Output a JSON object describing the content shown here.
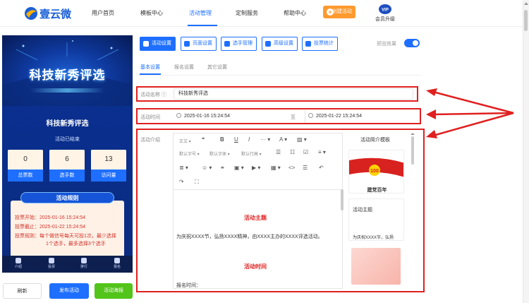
{
  "brand": {
    "name": "壹云微",
    "accent": "#1e6fff",
    "orange": "#ff9a2e",
    "green": "#52c41a",
    "alert": "#e02020"
  },
  "nav": {
    "items": [
      "用户首页",
      "模板中心",
      "活动管理",
      "定制服务",
      "帮助中心"
    ],
    "active": "活动管理",
    "create": "创建活动",
    "vip_badge": "VIP",
    "vip_label": "会员升级"
  },
  "preview": {
    "banner_title": "科技新秀评选",
    "activity_title": "科技新秀评选",
    "status": "活动已结束",
    "stats": [
      {
        "value": "0",
        "label": "总票数"
      },
      {
        "value": "6",
        "label": "选手数"
      },
      {
        "value": "13",
        "label": "访问量"
      }
    ],
    "rules_heading": "活动规则",
    "rules": [
      "投票开始：2025-01-16 15:24:54",
      "投票截止：2025-01-22 15:24:54",
      "投票规则：每个微信号每天可投1次，最少选择",
      "1个选手，最多选择3个选手"
    ],
    "bottom_nav": [
      "介绍",
      "投票",
      "排行",
      "报名"
    ]
  },
  "actions": {
    "refresh": "刷新",
    "publish": "发布活动",
    "poster": "活动海报"
  },
  "toolbar": {
    "buttons": [
      "活动设置",
      "页面设置",
      "选手管理",
      "高级设置",
      "投票统计"
    ],
    "preview_label": "预览效果",
    "preview_on": true
  },
  "tabs": [
    "基本设置",
    "报名设置",
    "其它设置"
  ],
  "form": {
    "name_label": "活动名称",
    "name_value": "科技新秀评选",
    "time_label": "活动时间",
    "start": "2025-01-16 15:24:54",
    "separator": "至",
    "end": "2025-01-22 15:24:54",
    "intro_label": "活动介绍"
  },
  "editor": {
    "row1": [
      "正文",
      "❝",
      "B",
      "U",
      "I",
      "···",
      "A",
      "▨"
    ],
    "row2": [
      "默认字号",
      "默认字体",
      "默认行高",
      "☰",
      "☷",
      "☑",
      "≡"
    ],
    "row3": [
      "≣",
      "☺",
      "⚭",
      "▣",
      "▶",
      "▦",
      "<>",
      "☰",
      "↶"
    ],
    "row4": [
      "↷",
      "⛶"
    ],
    "heading1": "活动主题",
    "paragraph1": "为庆祝XXXX节，弘扬XXXX精神，由XXXX主办的XXXX评选活动。",
    "heading2": "活动时间",
    "paragraph2": "报名时间："
  },
  "templates": {
    "title": "活动简介模板",
    "card1_caption": "建党百年",
    "card2_title": "活动主题",
    "card2_text": "为庆祝XXXX节，弘扬"
  }
}
